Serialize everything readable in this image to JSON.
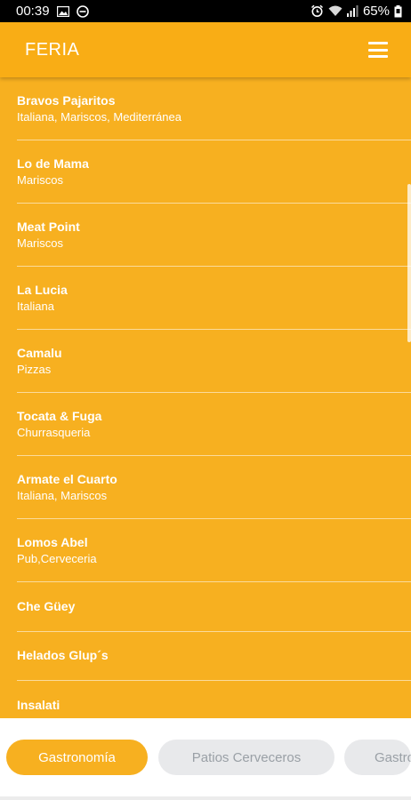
{
  "status_bar": {
    "time": "00:39",
    "battery": "65%",
    "left_icons": [
      "image-icon",
      "do-not-disturb-icon"
    ],
    "right_icons": [
      "alarm-icon",
      "wifi-icon",
      "signal-icon",
      "battery-icon"
    ]
  },
  "app_bar": {
    "title": "FERIA",
    "menu_icon": "hamburger-menu-icon"
  },
  "restaurants": [
    {
      "name": "Bravos Pajaritos",
      "category": "Italiana, Mariscos, Mediterránea"
    },
    {
      "name": "Lo de Mama",
      "category": "Mariscos"
    },
    {
      "name": "Meat Point",
      "category": "Mariscos"
    },
    {
      "name": "La Lucia",
      "category": "Italiana"
    },
    {
      "name": "Camalu",
      "category": "Pizzas"
    },
    {
      "name": "Tocata & Fuga",
      "category": "Churrasqueria"
    },
    {
      "name": "Armate el Cuarto",
      "category": "Italiana, Mariscos"
    },
    {
      "name": "Lomos Abel",
      "category": "Pub,Cerveceria"
    },
    {
      "name": "Che Güey",
      "category": ""
    },
    {
      "name": "Helados Glup´s",
      "category": ""
    },
    {
      "name": "Insalati",
      "category": ""
    }
  ],
  "tabs": [
    {
      "label": "Gastronomía",
      "active": true
    },
    {
      "label": "Patios Cerveceros",
      "active": false
    },
    {
      "label": "Gastro",
      "active": false
    }
  ],
  "colors": {
    "accent": "#f7b020",
    "app_bar": "#f9ad15",
    "inactive_tab_bg": "#e8e9eb",
    "inactive_tab_text": "#9aa0a6"
  }
}
